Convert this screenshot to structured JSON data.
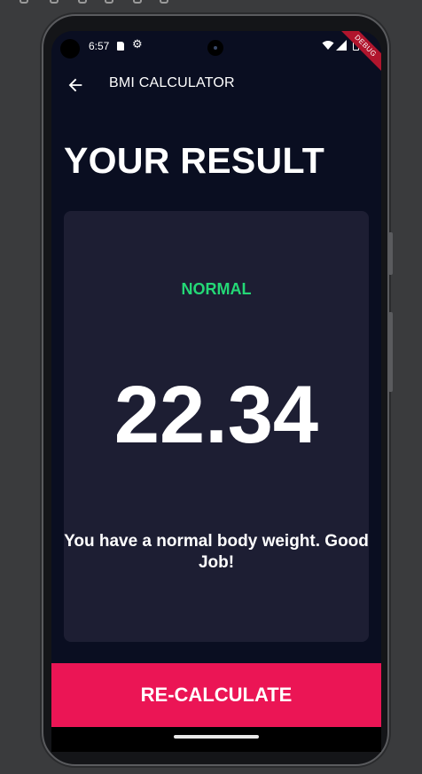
{
  "status_bar": {
    "time": "6:57",
    "debug_label": "DEBUG"
  },
  "app_bar": {
    "title": "BMI CALCULATOR",
    "back_icon": "back-arrow-icon"
  },
  "page": {
    "heading": "YOUR RESULT"
  },
  "result": {
    "category": "NORMAL",
    "bmi": "22.34",
    "interpretation": "You have a normal body weight. Good Job!"
  },
  "actions": {
    "recalculate_label": "RE-CALCULATE"
  },
  "colors": {
    "background": "#0a0e21",
    "card": "#1d1e33",
    "category_green": "#24d876",
    "accent_pink": "#eb1555"
  }
}
